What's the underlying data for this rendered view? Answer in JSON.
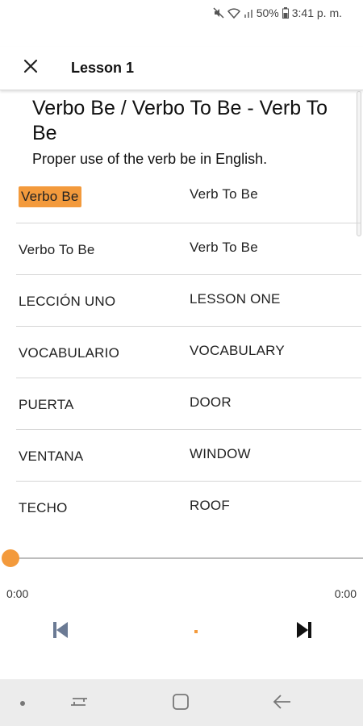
{
  "status": {
    "battery": "50%",
    "time": "3:41 p. m."
  },
  "header": {
    "title": "Lesson 1"
  },
  "lesson": {
    "title": "Verbo Be / Verbo To Be - Verb To Be",
    "subtitle": "Proper use of the verb be in English."
  },
  "rows": [
    {
      "es": "Verbo Be",
      "en": "Verb To Be",
      "highlighted": true
    },
    {
      "es": "Verbo To Be",
      "en": "Verb To Be"
    },
    {
      "es": "LECCIÓN UNO",
      "en": "LESSON ONE"
    },
    {
      "es": "VOCABULARIO",
      "en": "VOCABULARY"
    },
    {
      "es": "PUERTA",
      "en": "DOOR"
    },
    {
      "es": "VENTANA",
      "en": "WINDOW"
    },
    {
      "es": "TECHO",
      "en": "ROOF"
    }
  ],
  "player": {
    "current_time": "0:00",
    "total_time": "0:00",
    "progress": 0
  },
  "colors": {
    "accent": "#f39a3c",
    "divider": "#d6d6d6",
    "nav_bar": "#ececec"
  },
  "icons": {
    "close": "close-icon",
    "previous": "skip-previous-icon",
    "play": "play-icon",
    "next": "skip-next-icon",
    "mute": "mute-icon",
    "wifi": "wifi-icon",
    "signal": "signal-icon",
    "battery": "battery-icon",
    "nav_menu": "nav-dot-icon",
    "recents": "recents-icon",
    "home": "home-icon",
    "back": "back-icon"
  }
}
